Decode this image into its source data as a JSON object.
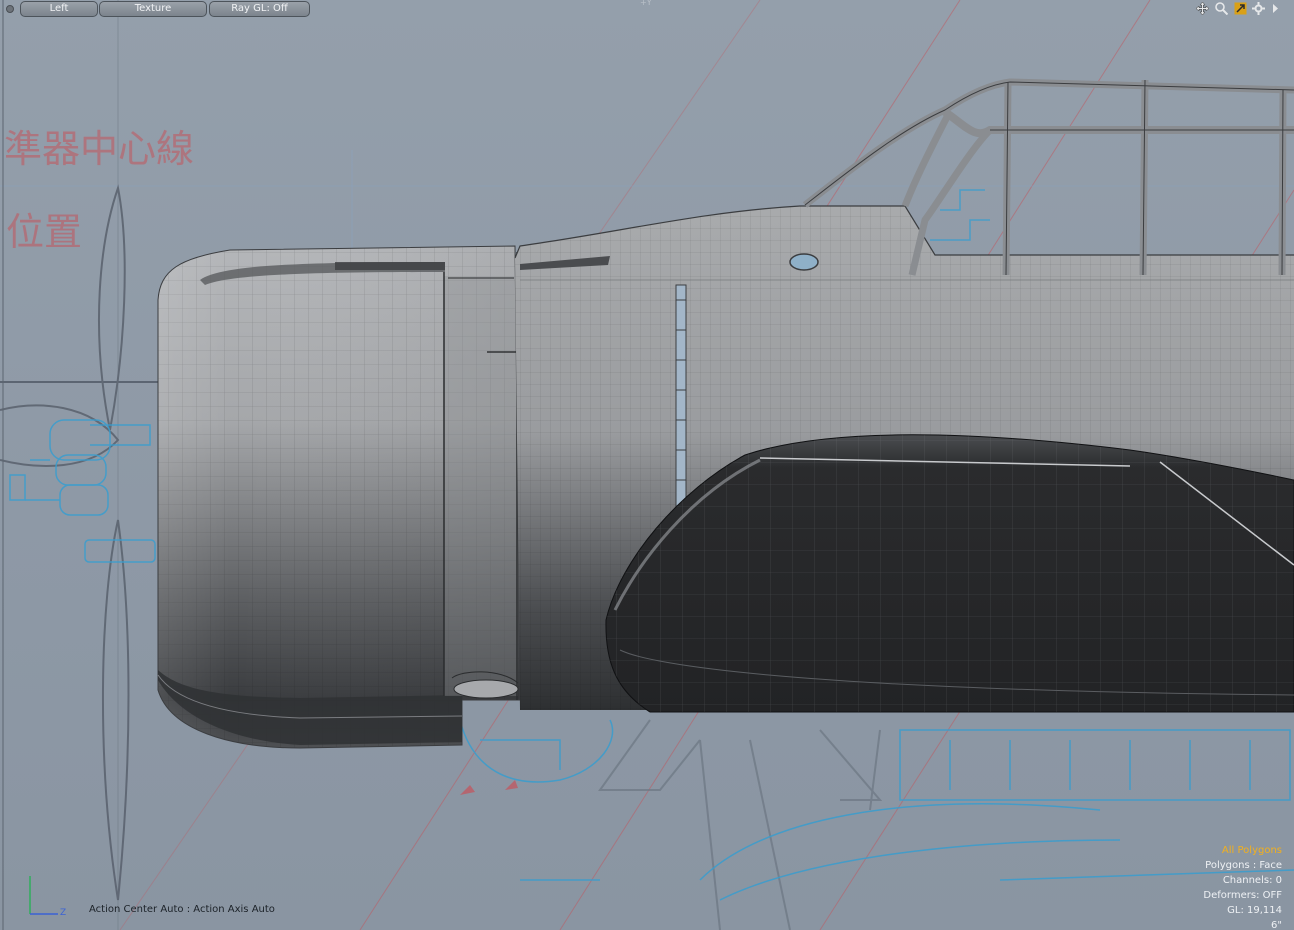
{
  "toolbar": {
    "view_label": "Left",
    "shading_label": "Texture",
    "raygl_label": "Ray GL: Off"
  },
  "viewport": {
    "axis_top_label": "+Y",
    "icons": [
      "move-view-icon",
      "zoom-view-icon",
      "fit-view-icon",
      "settings-icon",
      "expand-arrow-icon"
    ]
  },
  "blueprint": {
    "text_line1": "準器中心線",
    "text_line2": "位置"
  },
  "status": {
    "action_center": "Action Center Auto : Action Axis Auto"
  },
  "info": {
    "title": "All Polygons",
    "polygons": "Polygons : Face",
    "channels": "Channels: 0",
    "deformers": "Deformers: OFF",
    "gl": "GL: 19,114",
    "scale": "6\""
  },
  "gizmo": {
    "axis_label": "Z"
  },
  "colors": {
    "accent": "#f2b01e",
    "background": "#8e99a6",
    "blueprint_red": "#c4545c",
    "blueprint_blue": "#2f9ed4"
  }
}
